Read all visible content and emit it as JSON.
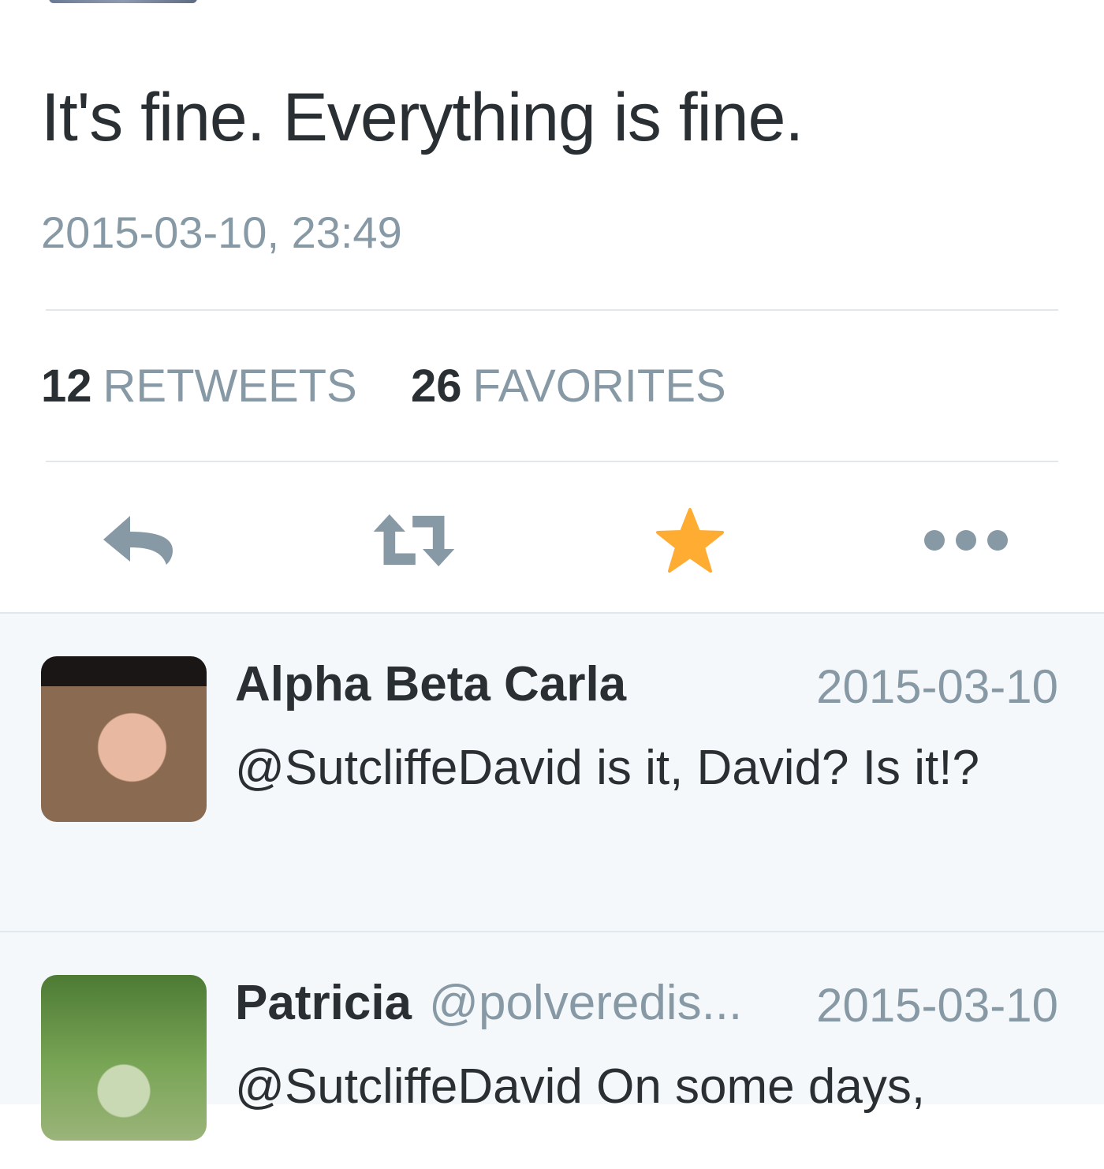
{
  "tweet": {
    "text": "It's fine. Everything is fine.",
    "timestamp": "2015-03-10, 23:49"
  },
  "stats": {
    "retweets_count": "12",
    "retweets_label": "RETWEETS",
    "favorites_count": "26",
    "favorites_label": "FAVORITES"
  },
  "actions": {
    "reply_icon": "reply-icon",
    "retweet_icon": "retweet-icon",
    "favorite_icon": "star-icon",
    "favorite_color": "#ffac33",
    "more_icon": "more-icon",
    "icon_color": "#8899a6"
  },
  "replies": [
    {
      "name": "Alpha Beta Carla",
      "handle": "",
      "date": "2015-03-10",
      "text": "@SutcliffeDavid is it, David? Is it!?"
    },
    {
      "name": "Patricia",
      "handle": "@polveredis...",
      "date": "2015-03-10",
      "text": "@SutcliffeDavid On some days,"
    }
  ]
}
